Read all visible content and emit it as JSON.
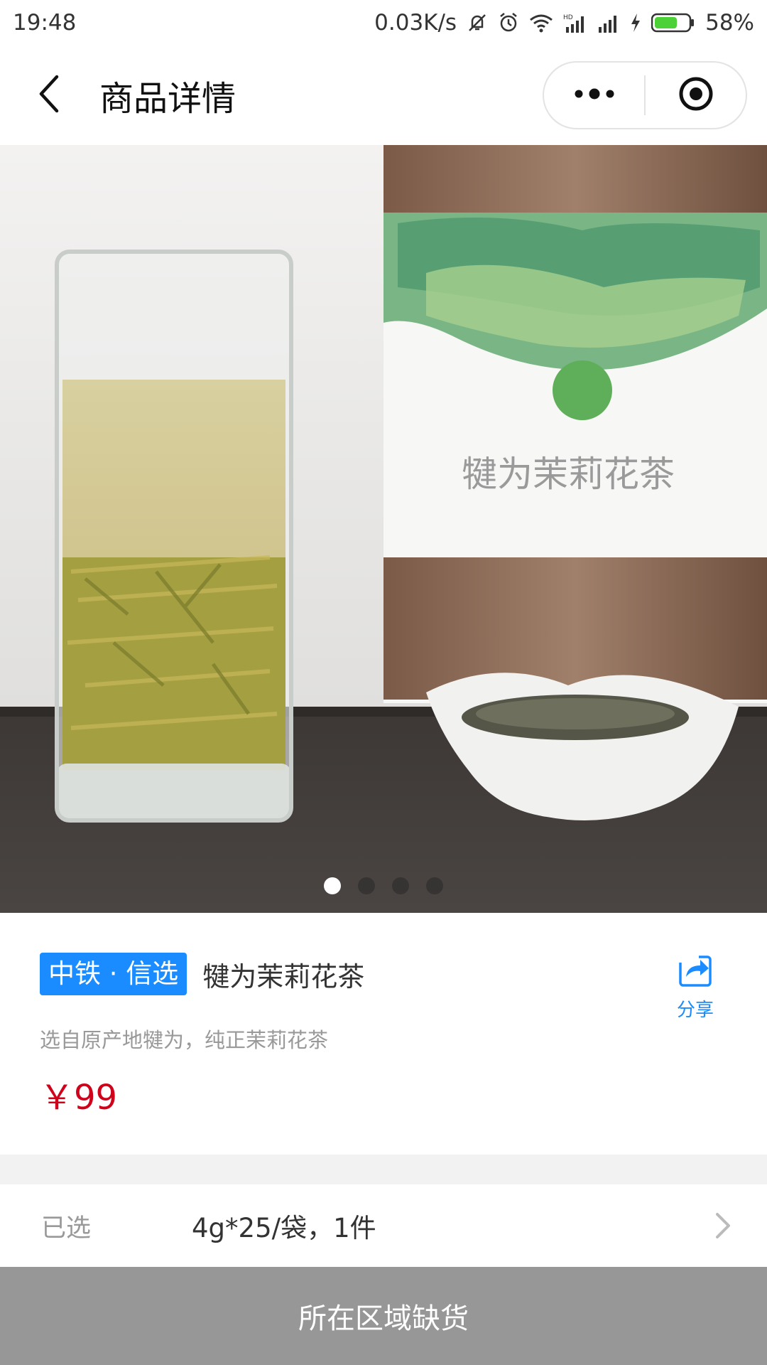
{
  "status_bar": {
    "time": "19:48",
    "net_speed": "0.03K/s",
    "battery": "58%",
    "icons": [
      "mute-icon",
      "alarm-icon",
      "wifi-icon",
      "hd-signal-icon",
      "signal-icon",
      "charging-icon",
      "battery-icon"
    ]
  },
  "nav": {
    "title": "商品详情",
    "icons": [
      "back-arrow-icon",
      "more-dots-icon",
      "record-target-icon"
    ]
  },
  "hero": {
    "box_text": "犍为茉莉花茶",
    "slides_total": 4,
    "active_slide": 1
  },
  "product": {
    "badge": "中铁 · 信选",
    "name": "犍为茉莉花茶",
    "subtitle": "选自原产地犍为，纯正茉莉花茶",
    "price": "￥99",
    "share_label": "分享"
  },
  "selection": {
    "label": "已选",
    "value": "4g*25/袋，1件"
  },
  "bottom": {
    "button_label": "所在区域缺货"
  },
  "colors": {
    "accent": "#1a8cff",
    "price": "#d0021b",
    "disabled_button": "#979797",
    "battery_green": "#4cd137"
  }
}
